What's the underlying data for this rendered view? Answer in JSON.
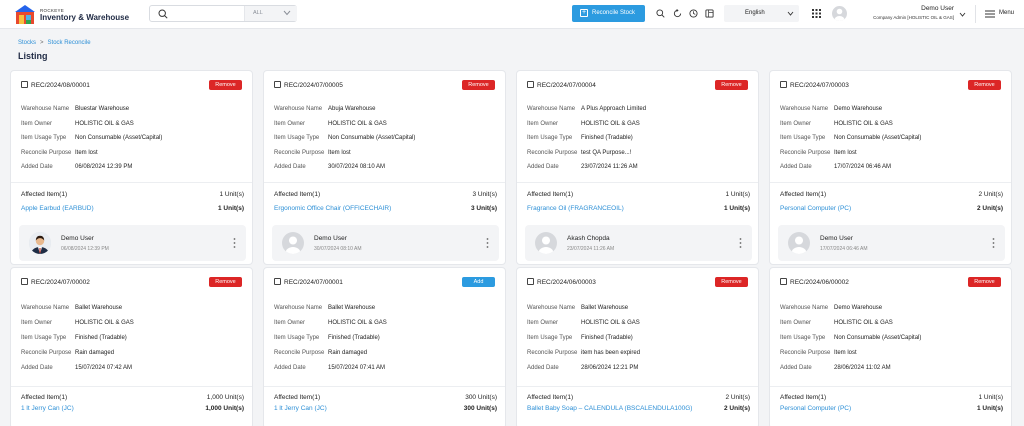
{
  "brand": {
    "small": "ROCKEYE",
    "name": "Inventory & Warehouse"
  },
  "search": {
    "value": "",
    "placeholder": "",
    "scope": "ALL"
  },
  "toolbar": {
    "reconcile_label": "Reconcile Stock"
  },
  "language": {
    "selected": "English"
  },
  "user": {
    "name": "Demo User",
    "role": "Company Admin [HOLISTIC OIL & GAS]"
  },
  "menu": {
    "label": "Menu"
  },
  "breadcrumb": {
    "items": [
      "Stocks",
      "Stock Reconcile"
    ],
    "separator": ">"
  },
  "page": {
    "title": "Listing"
  },
  "labels": {
    "warehouse": "Warehouse Name",
    "owner": "Item Owner",
    "usage": "Item Usage Type",
    "purpose": "Reconcile Purpose",
    "added": "Added Date"
  },
  "cards": [
    {
      "ref": "REC/2024/08/00001",
      "action": "Remove",
      "warehouse": "Bluestar Warehouse",
      "owner": "HOLISTIC OIL & GAS",
      "usage": "Non Consumable (Asset/Capital)",
      "purpose": "Item lost",
      "added": "06/08/2024 12:39 PM",
      "affected": "Affected Item(1)",
      "affected_units": "1 Unit(s)",
      "item": "Apple Earbud (EARBUD)",
      "item_units": "1 Unit(s)",
      "user": "Demo User",
      "user_date": "06/08/2024 12:39 PM",
      "photo": true
    },
    {
      "ref": "REC/2024/07/00005",
      "action": "Remove",
      "warehouse": "Abuja Warehouse",
      "owner": "HOLISTIC OIL & GAS",
      "usage": "Non Consumable (Asset/Capital)",
      "purpose": "Item lost",
      "added": "30/07/2024 08:10 AM",
      "affected": "Affected Item(1)",
      "affected_units": "3 Unit(s)",
      "item": "Ergonomic Office Chair (OFFICECHAIR)",
      "item_units": "3 Unit(s)",
      "user": "Demo User",
      "user_date": "30/07/2024 08:10 AM",
      "photo": false
    },
    {
      "ref": "REC/2024/07/00004",
      "action": "Remove",
      "warehouse": "A Plus Approach Limited",
      "owner": "HOLISTIC OIL & GAS",
      "usage": "Finished (Tradable)",
      "purpose": "test QA Purpose...!",
      "added": "23/07/2024 11:26 AM",
      "affected": "Affected Item(1)",
      "affected_units": "1 Unit(s)",
      "item": "Fragrance Oil (FRAGRANCEOIL)",
      "item_units": "1 Unit(s)",
      "user": "Akash Chopda",
      "user_date": "23/07/2024 11:26 AM",
      "photo": false
    },
    {
      "ref": "REC/2024/07/00003",
      "action": "Remove",
      "warehouse": "Demo Warehouse",
      "owner": "HOLISTIC OIL & GAS",
      "usage": "Non Consumable (Asset/Capital)",
      "purpose": "Item lost",
      "added": "17/07/2024 06:46 AM",
      "affected": "Affected Item(1)",
      "affected_units": "2 Unit(s)",
      "item": "Personal Computer (PC)",
      "item_units": "2 Unit(s)",
      "user": "Demo User",
      "user_date": "17/07/2024 06:46 AM",
      "photo": false
    },
    {
      "ref": "REC/2024/07/00002",
      "action": "Remove",
      "warehouse": "Ballet Warehouse",
      "owner": "HOLISTIC OIL & GAS",
      "usage": "Finished (Tradable)",
      "purpose": "Rain damaged",
      "added": "15/07/2024 07:42 AM",
      "affected": "Affected Item(1)",
      "affected_units": "1,000 Unit(s)",
      "item": "1 lt Jerry Can (JC)",
      "item_units": "1,000 Unit(s)"
    },
    {
      "ref": "REC/2024/07/00001",
      "action": "Add",
      "warehouse": "Ballet Warehouse",
      "owner": "HOLISTIC OIL & GAS",
      "usage": "Finished (Tradable)",
      "purpose": "Rain damaged",
      "added": "15/07/2024 07:41 AM",
      "affected": "Affected Item(1)",
      "affected_units": "300 Unit(s)",
      "item": "1 lt Jerry Can (JC)",
      "item_units": "300 Unit(s)"
    },
    {
      "ref": "REC/2024/06/00003",
      "action": "Remove",
      "warehouse": "Ballet Warehouse",
      "owner": "HOLISTIC OIL & GAS",
      "usage": "Finished (Tradable)",
      "purpose": "item has been expired",
      "added": "28/06/2024 12:21 PM",
      "affected": "Affected Item(1)",
      "affected_units": "2 Unit(s)",
      "item": "Ballet Baby Soap – CALENDULA (BSCALENDULA100G)",
      "item_units": "2 Unit(s)"
    },
    {
      "ref": "REC/2024/06/00002",
      "action": "Remove",
      "warehouse": "Demo Warehouse",
      "owner": "HOLISTIC OIL & GAS",
      "usage": "Non Consumable (Asset/Capital)",
      "purpose": "Item lost",
      "added": "28/06/2024 11:02 AM",
      "affected": "Affected Item(1)",
      "affected_units": "1 Unit(s)",
      "item": "Personal Computer (PC)",
      "item_units": "1 Unit(s)"
    }
  ],
  "colors": {
    "accent": "#2c9be0",
    "remove": "#dc2626",
    "link": "#2c8fd6"
  }
}
